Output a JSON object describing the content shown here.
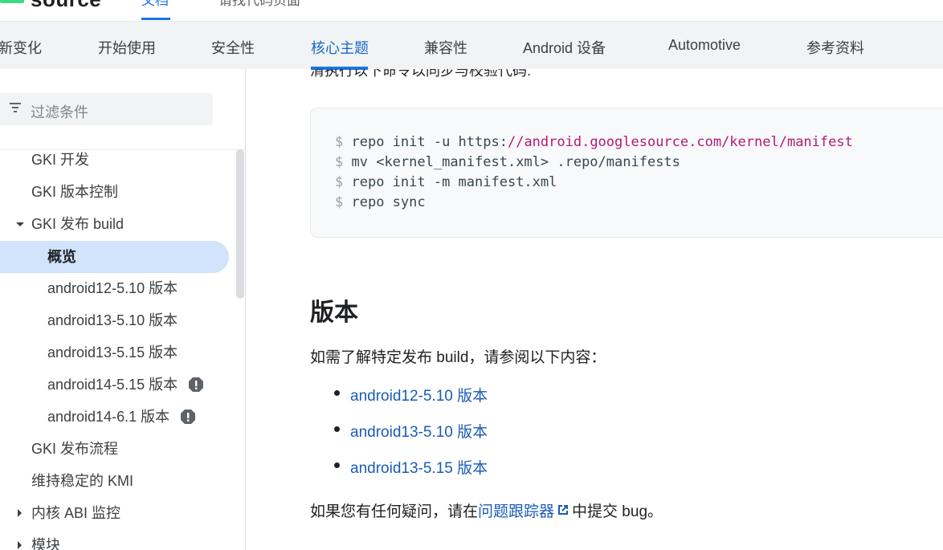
{
  "header": {
    "logo_text": "source",
    "tabs": [
      "文档",
      "请找代码页面"
    ]
  },
  "subnav": {
    "items": [
      "新变化",
      "开始使用",
      "安全性",
      "核心主题",
      "兼容性",
      "Android 设备",
      "Automotive",
      "参考资料"
    ],
    "active_index": 3
  },
  "sidebar": {
    "filter_placeholder": "过滤条件",
    "items": [
      {
        "label": "GKI 开发"
      },
      {
        "label": "GKI 版本控制"
      },
      {
        "label": "GKI 发布 build"
      },
      {
        "label": "概览"
      },
      {
        "label": "android12-5.10 版本"
      },
      {
        "label": "android13-5.10 版本"
      },
      {
        "label": "android13-5.15 版本"
      },
      {
        "label": "android14-5.15 版本"
      },
      {
        "label": "android14-6.1 版本"
      },
      {
        "label": "GKI 发布流程"
      },
      {
        "label": "维持稳定的 KMI"
      },
      {
        "label": "内核 ABI 监控"
      },
      {
        "label": "模块"
      }
    ]
  },
  "main": {
    "clipped_text": "清执行以下命令以同步与校验代码:",
    "code": {
      "prompt": "$",
      "lines": [
        {
          "cmd": "repo init -u https:",
          "url": "//android.googlesource.com/kernel/manifest"
        },
        {
          "cmd": "mv <kernel_manifest.xml> .repo/manifests",
          "url": ""
        },
        {
          "cmd": "repo init -m manifest.xml",
          "url": ""
        },
        {
          "cmd": "repo sync",
          "url": ""
        }
      ]
    },
    "heading": "版本",
    "intro": "如需了解特定发布 build，请参阅以下内容：",
    "links": [
      "android12-5.10 版本",
      "android13-5.10 版本",
      "android13-5.15 版本"
    ],
    "footer_prefix": "如果您有任何疑问，请在",
    "footer_link": "问题跟踪器",
    "footer_suffix": "中提交 bug。"
  }
}
